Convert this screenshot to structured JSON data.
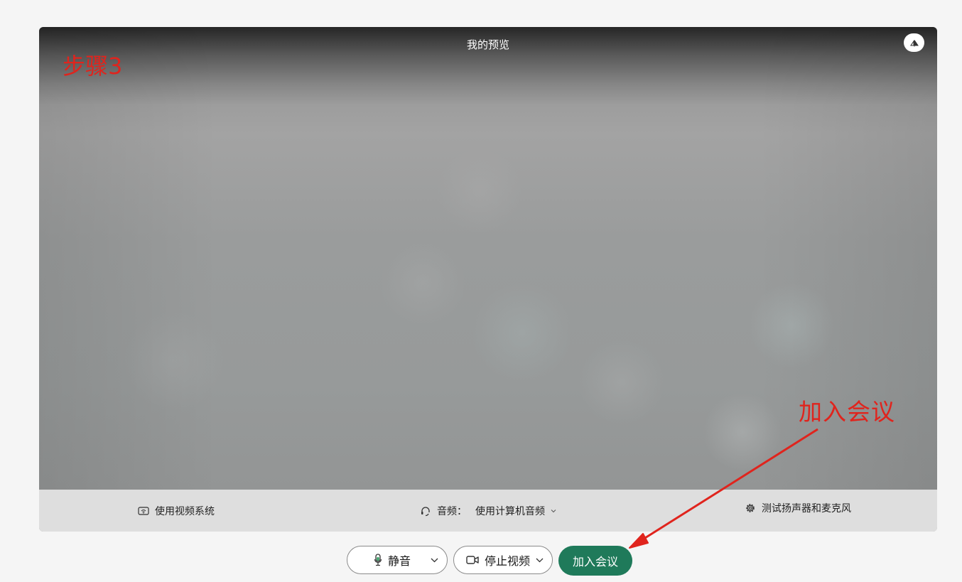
{
  "preview": {
    "title": "我的预览",
    "step_label": "步骤3"
  },
  "options": {
    "video_system_label": "使用视频系统",
    "audio_prefix": "音频：",
    "audio_value": "使用计算机音频",
    "test_label": "测试扬声器和麦克风"
  },
  "controls": {
    "mute_label": "静音",
    "stop_video_label": "停止视频",
    "join_label": "加入会议"
  },
  "annotation": {
    "text": "加入会议",
    "color": "#e0241d"
  },
  "colors": {
    "join_button": "#1f7a5a"
  },
  "icons": [
    "mirror-icon",
    "video-system-icon",
    "headset-icon",
    "gear-icon",
    "microphone-icon",
    "camera-icon",
    "chevron-down-icon"
  ]
}
